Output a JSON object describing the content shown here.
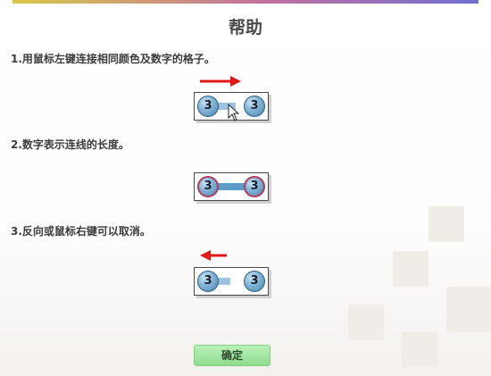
{
  "dialog": {
    "title": "帮助",
    "steps": [
      {
        "text": "1.用鼠标左键连接相同颜色及数字的格子。"
      },
      {
        "text": "2.数字表示连线的长度。"
      },
      {
        "text": "3.反向或鼠标右键可以取消。"
      }
    ],
    "confirm_label": "确定"
  },
  "demos": [
    {
      "left_number": "3",
      "right_number": "3"
    },
    {
      "left_number": "3",
      "right_number": "3"
    },
    {
      "left_number": "3",
      "right_number": "3"
    }
  ],
  "colors": {
    "accent_arrow": "#e01818",
    "ball_blue": "#7fb3d6",
    "path_blue": "#5b9bc8",
    "selected_ring": "#b33a5a",
    "button_green": "#8fdc8f"
  },
  "icons": [
    "arrow-right-icon",
    "arrow-left-icon",
    "mouse-cursor-icon"
  ]
}
